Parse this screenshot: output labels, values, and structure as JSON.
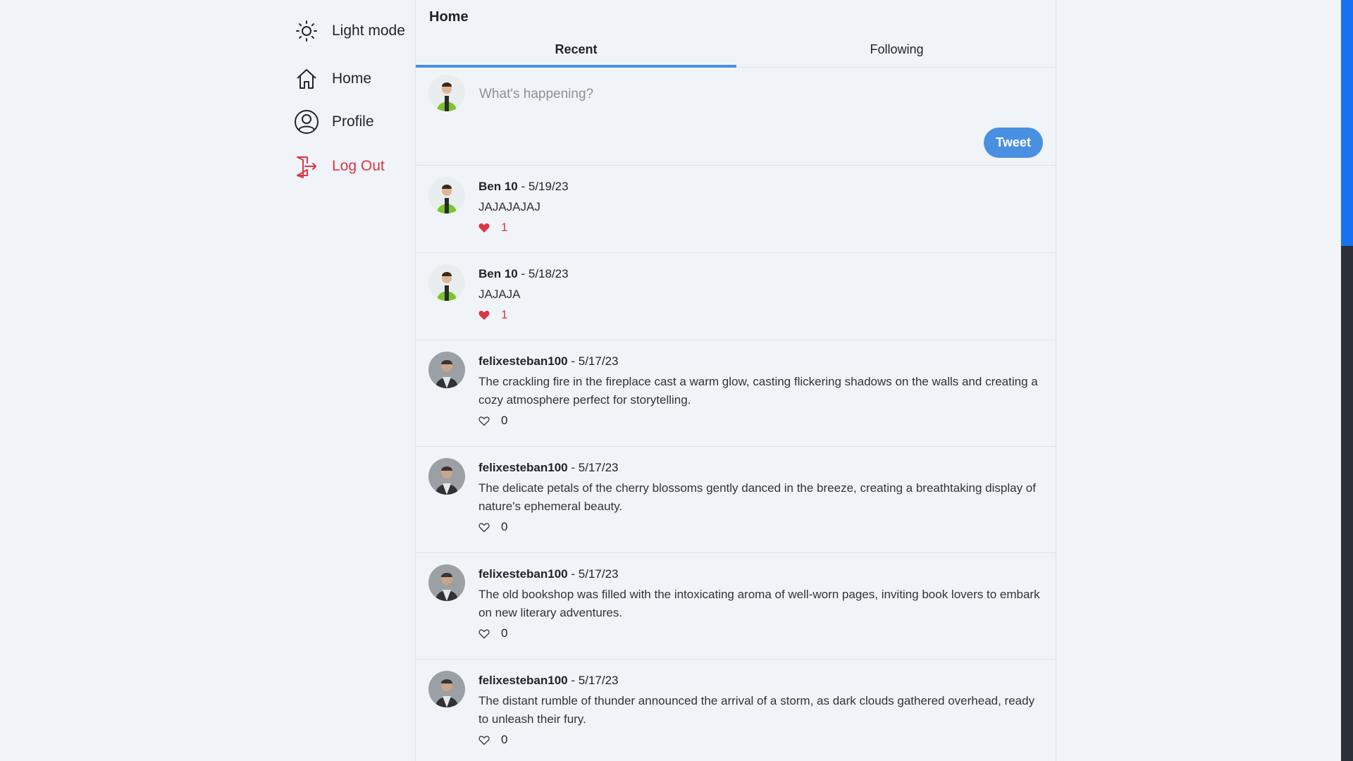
{
  "nav": {
    "theme_label": "Light mode",
    "home_label": "Home",
    "profile_label": "Profile",
    "logout_label": "Log Out"
  },
  "feed": {
    "title": "Home",
    "tabs": [
      {
        "label": "Recent",
        "active": true
      },
      {
        "label": "Following",
        "active": false
      }
    ]
  },
  "composer": {
    "placeholder": "What's happening?",
    "tweet_label": "Tweet"
  },
  "posts": [
    {
      "author": "Ben 10",
      "date": "- 5/19/23",
      "text": "JAJAJAJAJ",
      "likes": "1",
      "liked": true
    },
    {
      "author": "Ben 10",
      "date": "- 5/18/23",
      "text": "JAJAJA",
      "likes": "1",
      "liked": true
    },
    {
      "author": "felixesteban100",
      "date": "- 5/17/23",
      "text": "The crackling fire in the fireplace cast a warm glow, casting flickering shadows on the walls and creating a cozy atmosphere perfect for storytelling.",
      "likes": "0",
      "liked": false
    },
    {
      "author": "felixesteban100",
      "date": "- 5/17/23",
      "text": "The delicate petals of the cherry blossoms gently danced in the breeze, creating a breathtaking display of nature's ephemeral beauty.",
      "likes": "0",
      "liked": false
    },
    {
      "author": "felixesteban100",
      "date": "- 5/17/23",
      "text": "The old bookshop was filled with the intoxicating aroma of well-worn pages, inviting book lovers to embark on new literary adventures.",
      "likes": "0",
      "liked": false
    },
    {
      "author": "felixesteban100",
      "date": "- 5/17/23",
      "text": "The distant rumble of thunder announced the arrival of a storm, as dark clouds gathered overhead, ready to unleash their fury.",
      "likes": "0",
      "liked": false
    }
  ],
  "colors": {
    "accent": "#4a90e2",
    "danger": "#dc3545",
    "background": "#f0f4f8"
  },
  "icons": {
    "theme": "sun-icon",
    "home": "home-icon",
    "profile": "user-circle-icon",
    "logout": "logout-icon",
    "like_filled": "heart-filled-icon",
    "like_empty": "heart-outline-icon"
  }
}
